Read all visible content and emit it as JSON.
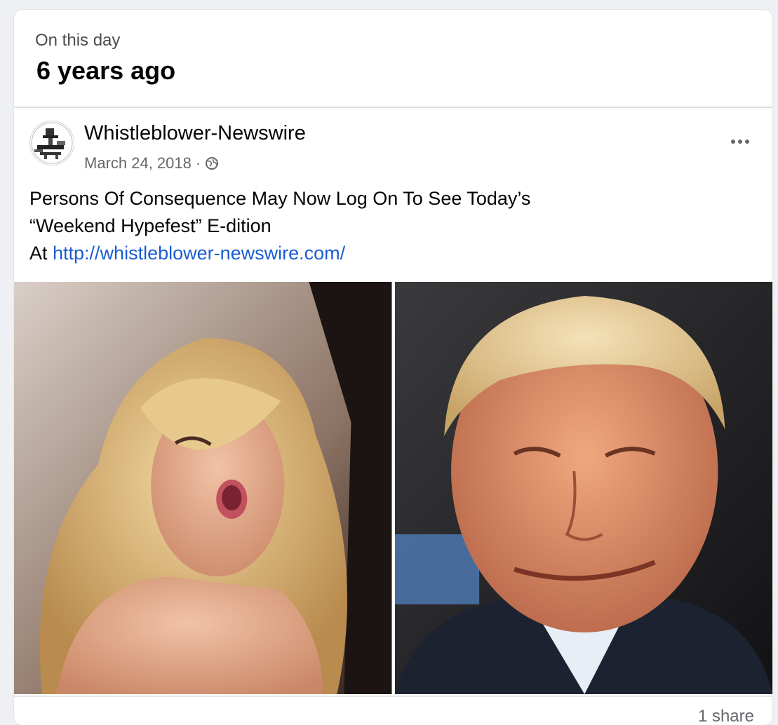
{
  "memory": {
    "subtitle": "On this day",
    "title": "6 years ago"
  },
  "post": {
    "page_name": "Whistleblower-Newswire",
    "date": "March 24, 2018",
    "separator": "·",
    "audience_icon": "globe-icon",
    "more_icon": "more-options-icon",
    "text_line1": "Persons Of Consequence May Now Log On To See Today’s",
    "text_line2": "“Weekend Hypefest” E-dition",
    "text_line3_prefix": "At ",
    "link": "http://whistleblower-newswire.com/",
    "photos": [
      {
        "name": "photo-left",
        "description_icon": "blonde-woman-photo"
      },
      {
        "name": "photo-right",
        "description_icon": "smiling-man-photo"
      }
    ],
    "shares": "1 share"
  },
  "colors": {
    "background": "#eef0f3",
    "card": "#ffffff",
    "link": "#1a5cd1",
    "meta": "#65676b"
  }
}
